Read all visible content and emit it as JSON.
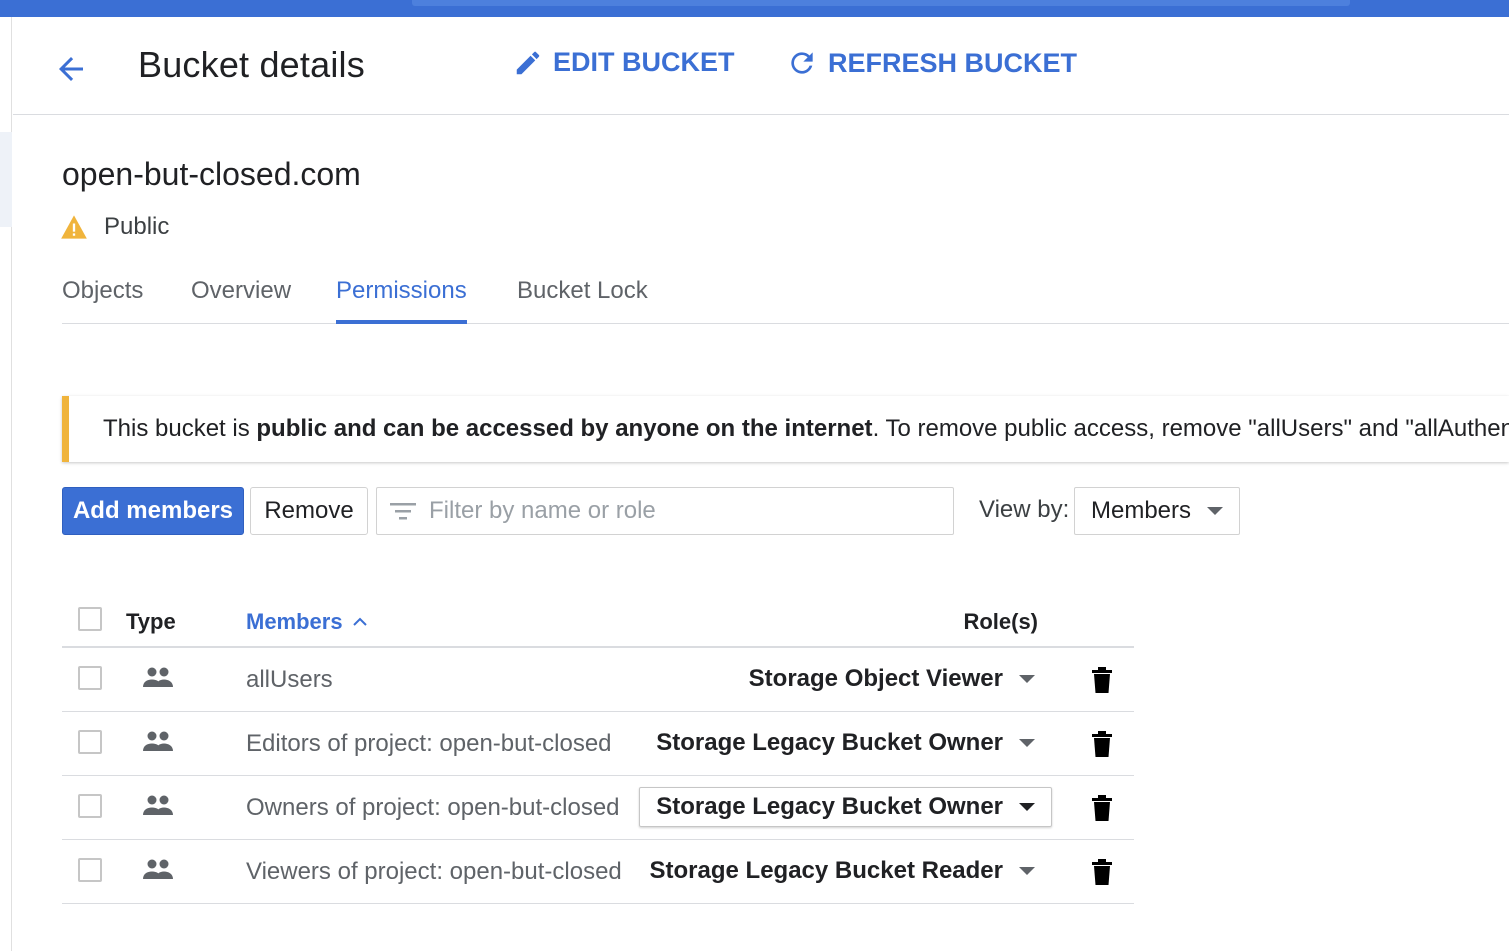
{
  "header": {
    "title": "Bucket details",
    "edit_label": "EDIT BUCKET",
    "refresh_label": "REFRESH BUCKET"
  },
  "bucket": {
    "name": "open-but-closed.com",
    "visibility": "Public"
  },
  "tabs": [
    {
      "label": "Objects",
      "active": false
    },
    {
      "label": "Overview",
      "active": false
    },
    {
      "label": "Permissions",
      "active": true
    },
    {
      "label": "Bucket Lock",
      "active": false
    }
  ],
  "warning": {
    "prefix": "This bucket is ",
    "bold": "public and can be accessed by anyone on the internet",
    "suffix": ". To remove public access, remove \"allUsers\" and \"allAuthentic"
  },
  "toolbar": {
    "add_label": "Add members",
    "remove_label": "Remove",
    "filter_placeholder": "Filter by name or role",
    "view_by_label": "View by:",
    "view_by_value": "Members"
  },
  "table": {
    "headers": {
      "type": "Type",
      "members": "Members",
      "roles": "Role(s)"
    },
    "rows": [
      {
        "type_icon": "group-icon",
        "member": "allUsers",
        "role": "Storage Object Viewer",
        "role_focused": false
      },
      {
        "type_icon": "group-icon",
        "member": "Editors of project: open-but-closed",
        "role": "Storage Legacy Bucket Owner",
        "role_focused": false
      },
      {
        "type_icon": "group-icon",
        "member": "Owners of project: open-but-closed",
        "role": "Storage Legacy Bucket Owner",
        "role_focused": true
      },
      {
        "type_icon": "group-icon",
        "member": "Viewers of project: open-but-closed",
        "role": "Storage Legacy Bucket Reader",
        "role_focused": false
      }
    ]
  },
  "colors": {
    "accent": "#3b6fd4",
    "warning": "#f0b43c"
  }
}
